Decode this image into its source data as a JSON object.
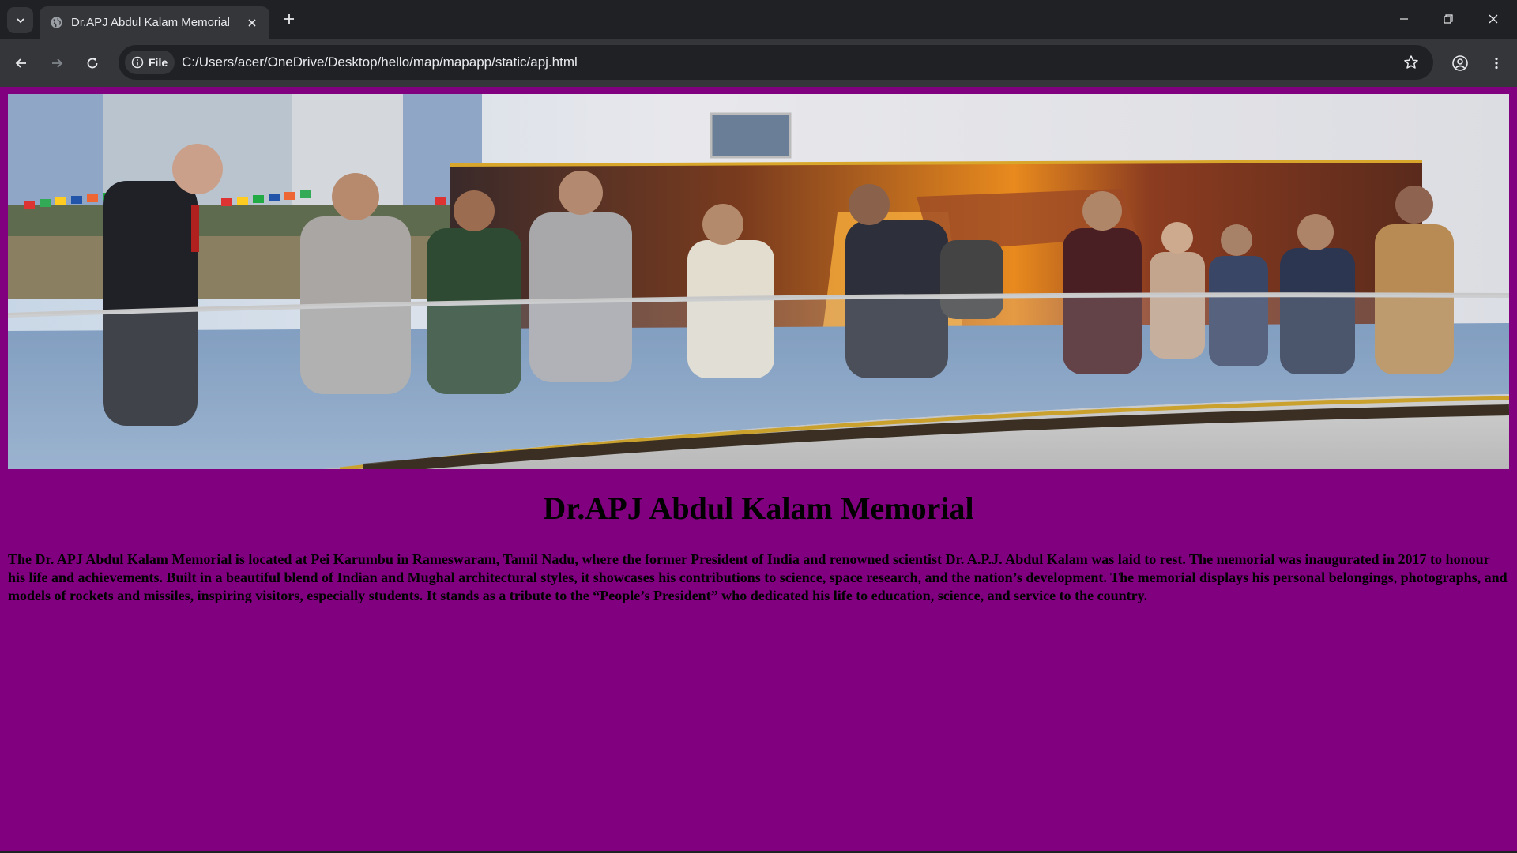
{
  "browser": {
    "tab_title": "Dr.APJ Abdul Kalam Memorial",
    "scheme_chip": "File",
    "url": "C:/Users/acer/OneDrive/Desktop/hello/map/mapapp/static/apj.html"
  },
  "page": {
    "background_color": "#800080",
    "hero_image": "memorial-wax-statues-photo",
    "heading": "Dr.APJ Abdul Kalam Memorial",
    "paragraph": "The Dr. APJ Abdul Kalam Memorial is located at Pei Karumbu in Rameswaram, Tamil Nadu, where the former President of India and renowned scientist Dr. A.P.J. Abdul Kalam was laid to rest. The memorial was inaugurated in 2017 to honour his life and achievements. Built in a beautiful blend of Indian and Mughal architectural styles, it showcases his contributions to science, space research, and the nation’s development. The memorial displays his personal belongings, photographs, and models of rockets and missiles, inspiring visitors, especially students. It stands as a tribute to the “People’s President” who dedicated his life to education, science, and service to the country."
  }
}
